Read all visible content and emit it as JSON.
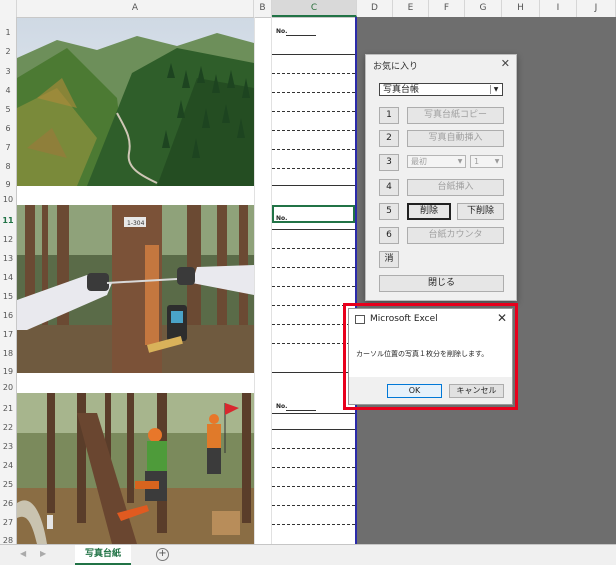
{
  "columns": [
    "A",
    "B",
    "C",
    "D",
    "E",
    "F",
    "G",
    "H",
    "I",
    "J"
  ],
  "rows": [
    "1",
    "2",
    "3",
    "4",
    "5",
    "6",
    "7",
    "8",
    "9",
    "10",
    "11",
    "12",
    "13",
    "14",
    "15",
    "16",
    "17",
    "18",
    "19",
    "20",
    "21",
    "22",
    "23",
    "24",
    "25",
    "26",
    "27",
    "28"
  ],
  "sheet": {
    "no_label": "No.",
    "photos": [
      {
        "name": "forest-valley-photo"
      },
      {
        "name": "tree-measurement-photo",
        "tag_text": "1-304"
      },
      {
        "name": "chainsaw-workers-photo"
      }
    ]
  },
  "userform": {
    "title": "お気に入り",
    "close": "✕",
    "combo_value": "写真台帳",
    "buttons": {
      "n1": "1",
      "copy": "写真台紙コピー",
      "n2": "2",
      "auto_insert": "写真自動挿入",
      "n3": "3",
      "sel1": "最初",
      "sel2": "1",
      "n4": "4",
      "insert": "台紙挿入",
      "n5": "5",
      "delete": "削除",
      "delete_below": "下削除",
      "n6": "6",
      "count": "台紙カウンタ",
      "clear": "消",
      "close": "閉じる"
    }
  },
  "msgbox": {
    "title": "Microsoft Excel",
    "close": "✕",
    "message": "カーソル位置の写真１枚分を削除します。",
    "ok": "OK",
    "cancel": "キャンセル"
  },
  "tabs": {
    "active": "写真台紙",
    "add": "+"
  },
  "colors": {
    "excel_green": "#217346",
    "highlight_red": "#e8001c",
    "border_blue": "#2b2baa"
  }
}
